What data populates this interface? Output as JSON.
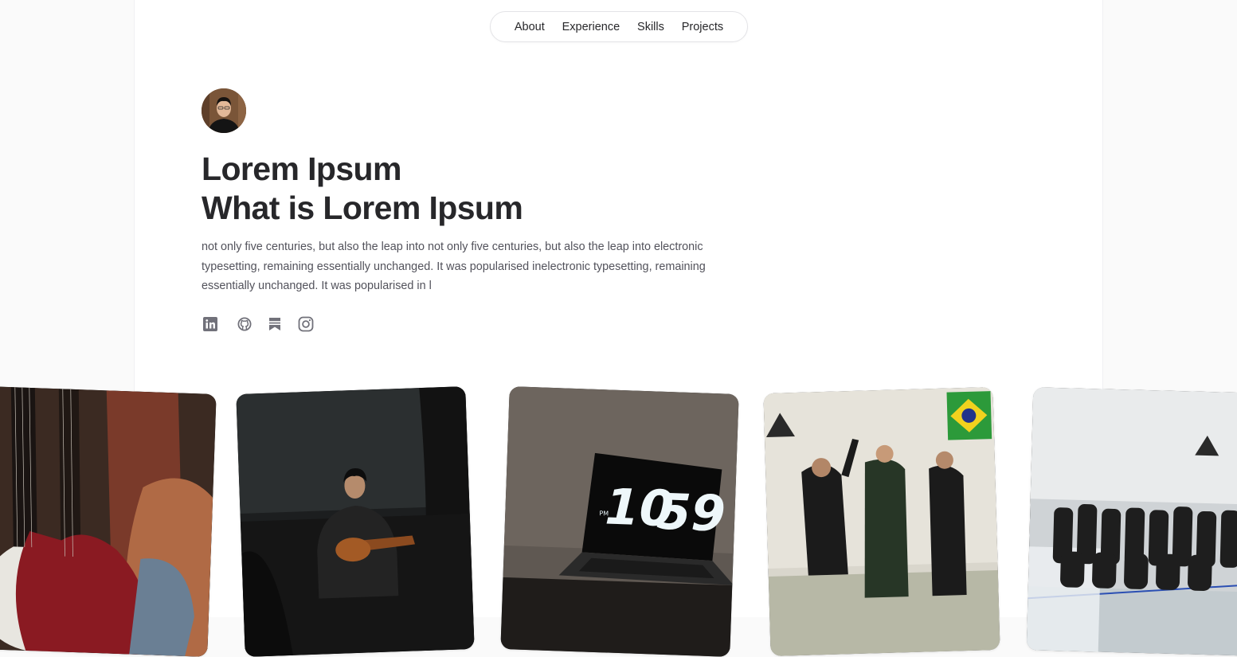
{
  "nav": {
    "items": [
      {
        "label": "About"
      },
      {
        "label": "Experience"
      },
      {
        "label": "Skills"
      },
      {
        "label": "Projects"
      }
    ]
  },
  "hero": {
    "title_line1": "Lorem Ipsum",
    "title_line2": "What is Lorem Ipsum",
    "bio": "not only five centuries, but also the leap into not only five centuries, but also the leap into electronic typesetting, remaining essentially unchanged. It was popularised inelectronic typesetting, remaining essentially unchanged. It was popularised in l"
  },
  "social": {
    "icons": [
      "linkedin-icon",
      "github-icon",
      "bookmark-icon",
      "instagram-icon"
    ]
  },
  "photo_clock": {
    "ampm": "PM",
    "time_hours": "10",
    "time_minutes": "59"
  },
  "colors": {
    "text": "#27272a",
    "muted": "#52525b",
    "icon": "#71717a",
    "border": "#e4e4e7",
    "page_bg": "#fafafa"
  }
}
